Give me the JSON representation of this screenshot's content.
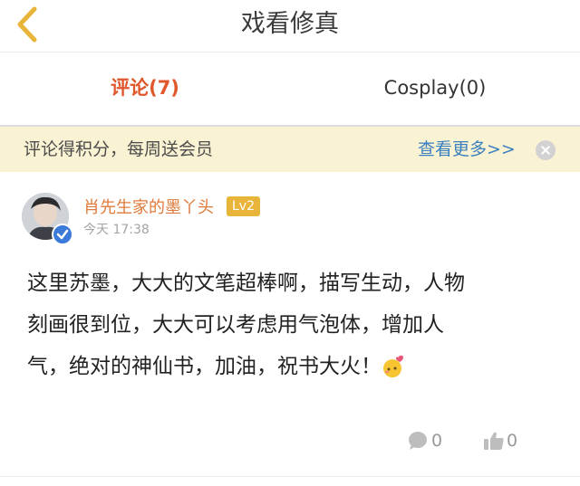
{
  "header": {
    "title": "戏看修真"
  },
  "tabs": [
    {
      "label": "评论(7)",
      "active": true
    },
    {
      "label": "Cosplay(0)",
      "active": false
    }
  ],
  "banner": {
    "text": "评论得积分，每周送会员",
    "link": "查看更多>>"
  },
  "comment": {
    "username": "肖先生家的墨丫头",
    "level": "Lv2",
    "time": "今天 17:38",
    "lines": [
      "这里苏墨，大大的文笔超棒啊，描写生动，人物",
      "刻画很到位，大大可以考虑用气泡体，增加人",
      "气，绝对的神仙书，加油，祝书大火！"
    ],
    "reply_count": "0",
    "like_count": "0"
  },
  "colors": {
    "accent": "#e0572c",
    "link": "#3a7fbf",
    "banner_bg": "#faf3d3",
    "level_bg": "#e9b43a",
    "username": "#e07a3a"
  }
}
